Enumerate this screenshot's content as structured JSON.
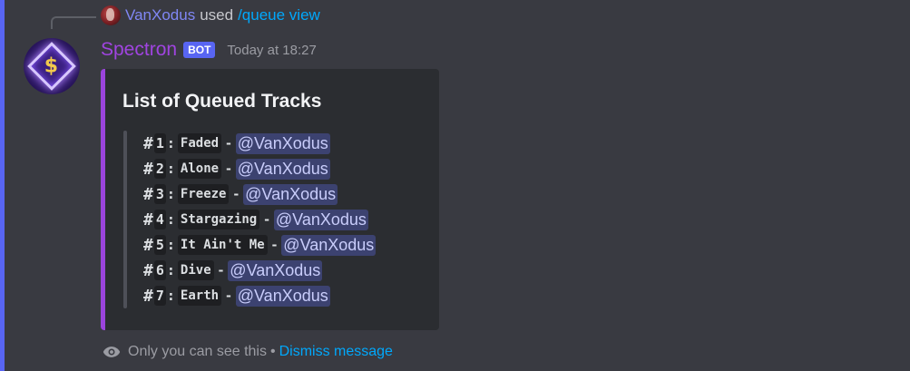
{
  "reply": {
    "user": "VanXodus",
    "used_text": "used",
    "command": "/queue view"
  },
  "message": {
    "author": "Spectron",
    "bot_tag": "BOT",
    "timestamp": "Today at 18:27"
  },
  "embed": {
    "title": "List of Queued Tracks",
    "items": [
      {
        "hash": "#",
        "number": "1",
        "colon": ":",
        "track": "Faded",
        "dash": "-",
        "mention": "@VanXodus"
      },
      {
        "hash": "#",
        "number": "2",
        "colon": ":",
        "track": "Alone",
        "dash": "-",
        "mention": "@VanXodus"
      },
      {
        "hash": "#",
        "number": "3",
        "colon": ":",
        "track": "Freeze",
        "dash": "-",
        "mention": "@VanXodus"
      },
      {
        "hash": "#",
        "number": "4",
        "colon": ":",
        "track": "Stargazing",
        "dash": "-",
        "mention": "@VanXodus"
      },
      {
        "hash": "#",
        "number": "5",
        "colon": ":",
        "track": "It Ain't Me",
        "dash": "-",
        "mention": "@VanXodus"
      },
      {
        "hash": "#",
        "number": "6",
        "colon": ":",
        "track": "Dive",
        "dash": "-",
        "mention": "@VanXodus"
      },
      {
        "hash": "#",
        "number": "7",
        "colon": ":",
        "track": "Earth",
        "dash": "-",
        "mention": "@VanXodus"
      }
    ]
  },
  "ephemeral": {
    "icon": "eye-icon",
    "text": "Only you can see this",
    "separator": "•",
    "dismiss": "Dismiss message"
  },
  "colors": {
    "background": "#393a41",
    "accent": "#5865f2",
    "author": "#a044e0",
    "embed_border": "#9b44dc",
    "link": "#00a8fc",
    "mention_bg": "#3c4270"
  }
}
